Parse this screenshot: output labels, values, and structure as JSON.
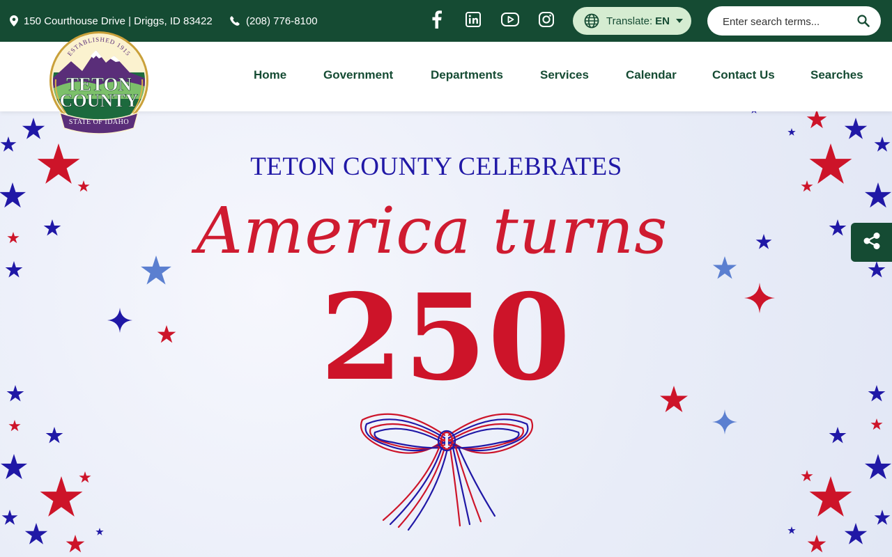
{
  "topbar": {
    "address": "150 Courthouse Drive | Driggs, ID 83422",
    "phone": "(208) 776-8100",
    "social": [
      {
        "icon": "facebook-icon"
      },
      {
        "icon": "linkedin-icon"
      },
      {
        "icon": "youtube-icon"
      },
      {
        "icon": "instagram-icon"
      }
    ],
    "translate": {
      "label": "Translate:",
      "lang": "EN"
    },
    "search": {
      "placeholder": "Enter search terms..."
    }
  },
  "logo": {
    "top_text": "ESTABLISHED 1915",
    "line1": "TETON",
    "line2": "COUNTY",
    "ribbon": "STATE OF IDAHO"
  },
  "nav": {
    "items": [
      {
        "label": "Home"
      },
      {
        "label": "Government"
      },
      {
        "label": "Departments"
      },
      {
        "label": "Services"
      },
      {
        "label": "Calendar"
      },
      {
        "label": "Contact Us"
      },
      {
        "label": "Searches"
      }
    ]
  },
  "hero": {
    "subtitle": "TETON COUNTY CELEBRATES",
    "script": "America turns",
    "number": "250"
  },
  "colors": {
    "brand_green": "#154b33",
    "translate_bg": "#d5ecd1",
    "celebration_red": "#cd1429",
    "celebration_blue": "#2018a6",
    "star_light_blue": "#5b7fd0"
  }
}
